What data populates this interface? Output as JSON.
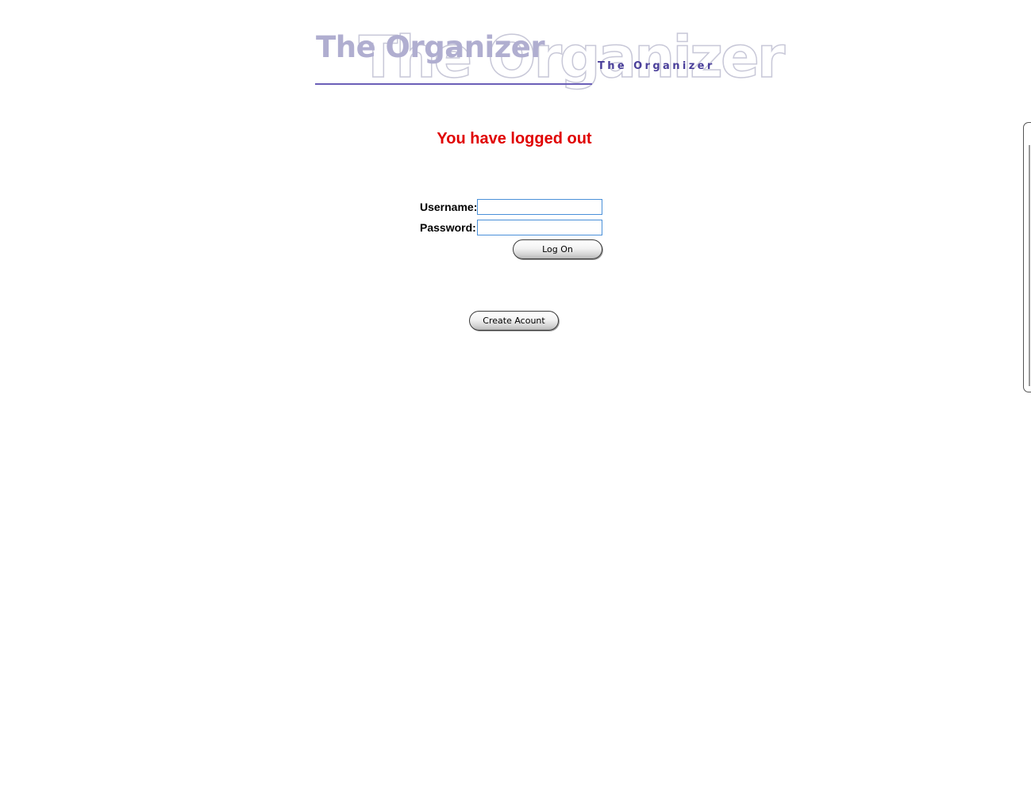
{
  "logo": {
    "watermark_text": "The Organizer",
    "main_text": "The Organizer",
    "small_text": "The Organizer"
  },
  "message": {
    "text": "You have logged out",
    "color": "#e00000"
  },
  "login_form": {
    "username_label": "Username:",
    "username_value": "",
    "password_label": "Password:",
    "password_value": "",
    "logon_button_label": "Log On"
  },
  "create_account": {
    "button_label": "Create Acount"
  },
  "colors": {
    "logo_main": "#b0aed0",
    "logo_small": "#4a3f9a",
    "logo_rule": "#6b5fb8",
    "input_border": "#4a90d9"
  }
}
